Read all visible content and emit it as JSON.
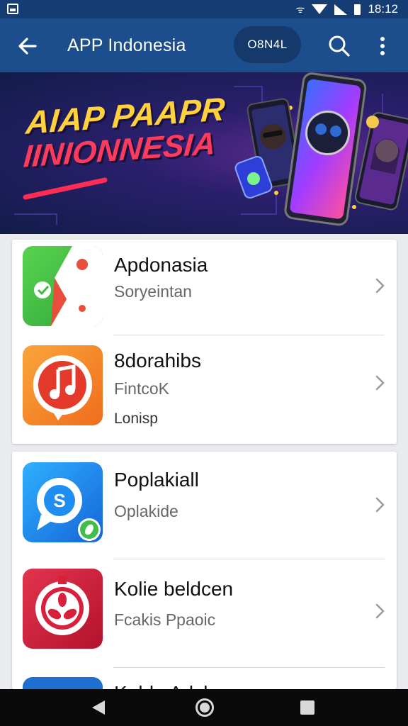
{
  "status_bar": {
    "time": "18:12",
    "icons": [
      "sim-icon",
      "vibrate-icon",
      "wifi-icon",
      "signal-icon",
      "battery-icon"
    ]
  },
  "app_bar": {
    "title": "APP Indonesia",
    "pill_label": "O8N4L",
    "icons": [
      "back-arrow-icon",
      "search-icon",
      "more-vert-icon"
    ]
  },
  "banner": {
    "line1": "AIAP PAAPR",
    "line2": "IINIONNESIA"
  },
  "apps": [
    {
      "name": "Apdonasia",
      "subtitle": "Soryeintan",
      "extra": "",
      "icon": "chat-bubble-app-icon",
      "color": "#3dbb3f"
    },
    {
      "name": "8dorahibs",
      "subtitle": "FintcoK",
      "extra": "Lonisp",
      "icon": "music-note-app-icon",
      "color": "#f28a24"
    },
    {
      "name": "Poplakiall",
      "subtitle": "Oplakide",
      "extra": "",
      "icon": "chat-s-app-icon",
      "color": "#1e8ff0"
    },
    {
      "name": "Kolie beldcen",
      "subtitle": "Fcakis Ppaoic",
      "extra": "",
      "icon": "flower-app-icon",
      "color": "#d81f3c"
    },
    {
      "name": "Kohla Adsher",
      "subtitle": "",
      "extra": "",
      "icon": "blue-app-icon",
      "color": "#1e6fd0"
    }
  ],
  "nav_bar": {
    "icons": [
      "back-triangle-icon",
      "home-circle-icon",
      "recents-square-icon"
    ]
  },
  "colors": {
    "app_bar": "#1c4d8c",
    "status_bar": "#163d73",
    "background": "#e9ebee"
  }
}
